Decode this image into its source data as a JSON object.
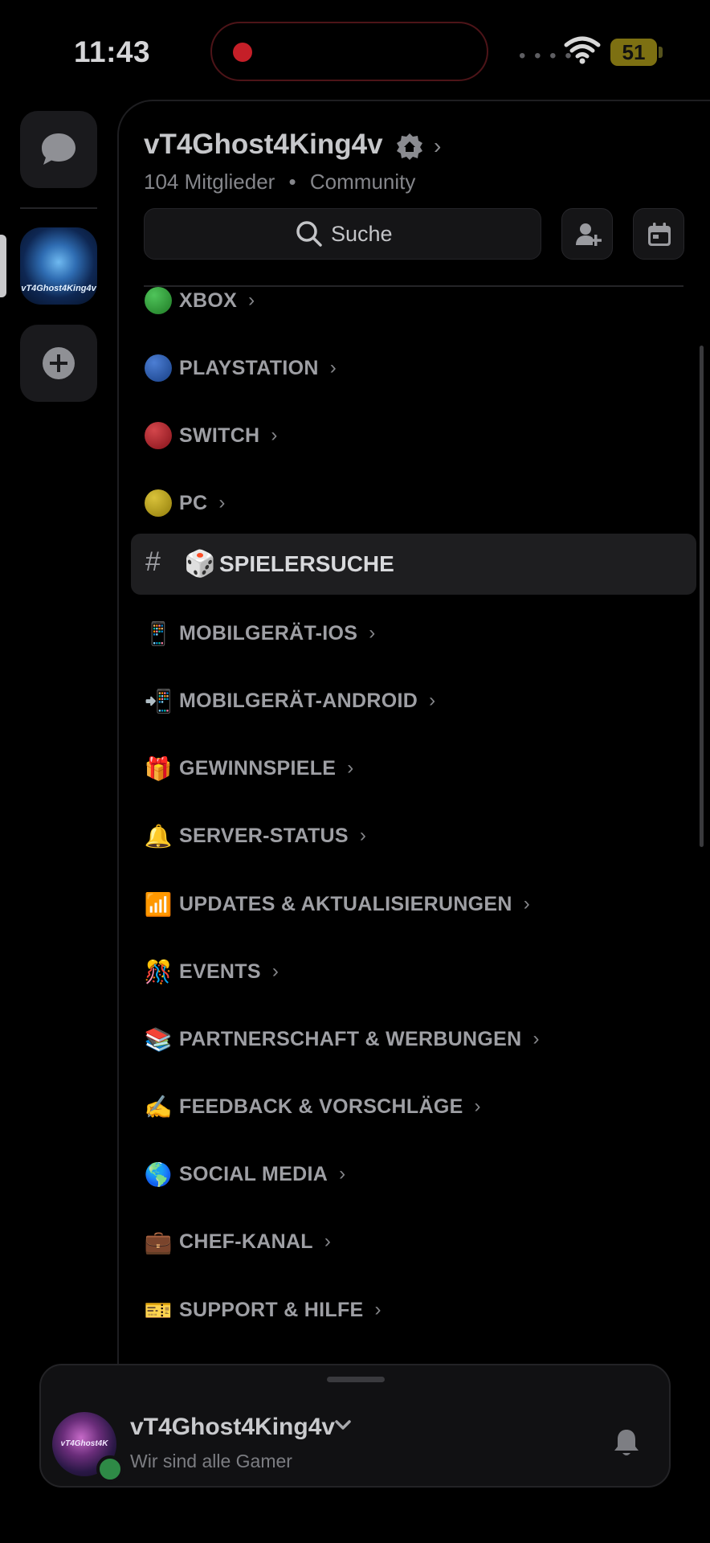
{
  "status_bar": {
    "time": "11:43",
    "battery": "51"
  },
  "server": {
    "name": "vT4Ghost4King4v",
    "members": "104 Mitglieder",
    "separator": "•",
    "type": "Community",
    "avatar_text": "vT4Ghost4King4v"
  },
  "search": {
    "label": "Suche"
  },
  "categories": [
    {
      "emoji": "green-circle",
      "label": "XBOX"
    },
    {
      "emoji": "blue-circle",
      "label": "PLAYSTATION"
    },
    {
      "emoji": "red-circle",
      "label": "SWITCH"
    },
    {
      "emoji": "yellow-circle",
      "label": "PC"
    },
    {
      "emoji": "📱",
      "label": "MOBILGERÄT-IOS"
    },
    {
      "emoji": "📲",
      "label": "MOBILGERÄT-ANDROID"
    },
    {
      "emoji": "🎁",
      "label": "GEWINNSPIELE"
    },
    {
      "emoji": "🔔",
      "label": "SERVER-STATUS"
    },
    {
      "emoji": "📶",
      "label": "UPDATES & AKTUALISIERUNGEN"
    },
    {
      "emoji": "🎊",
      "label": "EVENTS"
    },
    {
      "emoji": "📚",
      "label": "PARTNERSCHAFT & WERBUNGEN"
    },
    {
      "emoji": "✍",
      "label": "FEEDBACK & VORSCHLÄGE"
    },
    {
      "emoji": "🌎",
      "label": "SOCIAL MEDIA"
    },
    {
      "emoji": "💼",
      "label": "CHEF-KANAL"
    },
    {
      "emoji": "🎫",
      "label": "SUPPORT & HILFE"
    }
  ],
  "selected_channel": {
    "hash": "#",
    "emoji": "🎲",
    "label": "SPIELERSUCHE"
  },
  "user": {
    "name": "vT4Ghost4King4v",
    "status": "Wir sind alle Gamer",
    "avatar_text": "vT4Ghost4K"
  },
  "colors": {
    "green": "#2a8a2e",
    "blue": "#1f4f9c",
    "red": "#a3171d",
    "yellow": "#b39a10",
    "online": "#2e8a46",
    "recording": "#c51f28"
  }
}
